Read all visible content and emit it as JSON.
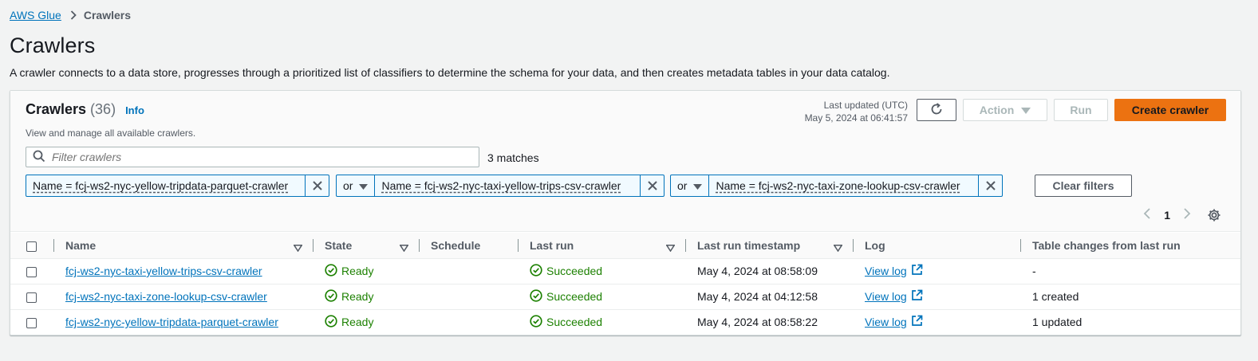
{
  "breadcrumb": {
    "root": "AWS Glue",
    "current": "Crawlers"
  },
  "page": {
    "title": "Crawlers",
    "description": "A crawler connects to a data store, progresses through a prioritized list of classifiers to determine the schema for your data, and then creates metadata tables in your data catalog."
  },
  "panel": {
    "title": "Crawlers",
    "count": "(36)",
    "info": "Info",
    "subtitle": "View and manage all available crawlers.",
    "last_updated_label": "Last updated (UTC)",
    "last_updated_value": "May 5, 2024 at 06:41:57",
    "action_label": "Action",
    "run_label": "Run",
    "create_label": "Create crawler"
  },
  "filter": {
    "placeholder": "Filter crawlers",
    "matches": "3 matches",
    "tokens": [
      {
        "operator": "",
        "label": "Name = fcj-ws2-nyc-yellow-tripdata-parquet-crawler"
      },
      {
        "operator": "or",
        "label": "Name = fcj-ws2-nyc-taxi-yellow-trips-csv-crawler"
      },
      {
        "operator": "or",
        "label": "Name = fcj-ws2-nyc-taxi-zone-lookup-csv-crawler"
      }
    ],
    "clear_label": "Clear filters"
  },
  "pagination": {
    "current_page": "1"
  },
  "table": {
    "columns": [
      "Name",
      "State",
      "Schedule",
      "Last run",
      "Last run timestamp",
      "Log",
      "Table changes from last run"
    ],
    "rows": [
      {
        "name": "fcj-ws2-nyc-taxi-yellow-trips-csv-crawler",
        "state": "Ready",
        "schedule": "",
        "last_run": "Succeeded",
        "timestamp": "May 4, 2024 at 08:58:09",
        "log": "View log",
        "changes": "-"
      },
      {
        "name": "fcj-ws2-nyc-taxi-zone-lookup-csv-crawler",
        "state": "Ready",
        "schedule": "",
        "last_run": "Succeeded",
        "timestamp": "May 4, 2024 at 04:12:58",
        "log": "View log",
        "changes": "1 created"
      },
      {
        "name": "fcj-ws2-nyc-yellow-tripdata-parquet-crawler",
        "state": "Ready",
        "schedule": "",
        "last_run": "Succeeded",
        "timestamp": "May 4, 2024 at 08:58:22",
        "log": "View log",
        "changes": "1 updated"
      }
    ]
  },
  "colors": {
    "link": "#0073bb",
    "primary": "#ec7211",
    "success": "#1d8102"
  },
  "icons": [
    "chevron-right-icon",
    "refresh-icon",
    "caret-down-icon",
    "search-icon",
    "close-icon",
    "chevron-left-icon",
    "gear-icon",
    "sort-caret-icon",
    "status-ok-icon",
    "external-link-icon"
  ]
}
